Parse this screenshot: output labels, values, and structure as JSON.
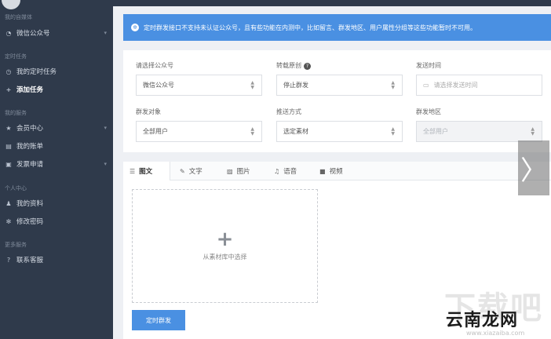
{
  "sidebar": {
    "sections": [
      {
        "title": "我的自媒体"
      },
      {
        "title": "定时任务"
      },
      {
        "title": "我的服务"
      },
      {
        "title": "个人中心"
      },
      {
        "title": "更多服务"
      }
    ],
    "items": [
      {
        "label": "微信公众号",
        "icon": "wechat-icon"
      },
      {
        "label": "我的定时任务",
        "icon": "clock-icon"
      },
      {
        "label": "添加任务",
        "icon": "plus-icon"
      },
      {
        "label": "会员中心",
        "icon": "star-icon"
      },
      {
        "label": "我的账单",
        "icon": "list-icon"
      },
      {
        "label": "发票申请",
        "icon": "invoice-icon"
      },
      {
        "label": "我的资料",
        "icon": "user-icon"
      },
      {
        "label": "修改密码",
        "icon": "gear-icon"
      },
      {
        "label": "联系客服",
        "icon": "question-icon"
      }
    ]
  },
  "banner": {
    "text": "定时群发接口不支持未认证公众号，且有些功能在内测中，比如留言、群发地区、用户属性分组等这些功能暂时不可用。"
  },
  "form": {
    "account_label": "请选择公众号",
    "account_value": "微信公众号",
    "reprint_label": "转载原创",
    "reprint_value": "停止群发",
    "send_time_label": "发送时间",
    "send_time_placeholder": "请选择发送时间",
    "target_label": "群发对象",
    "target_value": "全部用户",
    "push_label": "推送方式",
    "push_value": "选定素材",
    "region_label": "群发地区",
    "region_value": "全部用户"
  },
  "tabs": [
    {
      "label": "图文",
      "icon": "article-icon"
    },
    {
      "label": "文字",
      "icon": "edit-icon"
    },
    {
      "label": "图片",
      "icon": "image-icon"
    },
    {
      "label": "语音",
      "icon": "music-icon"
    },
    {
      "label": "视频",
      "icon": "video-icon"
    }
  ],
  "material": {
    "select_text": "从素材库中选择"
  },
  "submit_label": "定时群发",
  "watermark": {
    "ghost": "下载吧",
    "main": "云南龙网",
    "url": "www.xiazaiba.com"
  },
  "colors": {
    "sidebar_bg": "#2f3a4b",
    "accent": "#4a90e2"
  }
}
